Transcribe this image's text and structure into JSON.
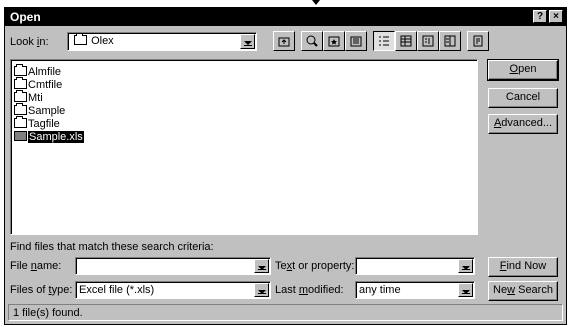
{
  "window": {
    "title": "Open",
    "help_glyph": "?",
    "close_glyph": "×"
  },
  "lookin": {
    "label_pre": "Look ",
    "label_u": "i",
    "label_post": "n:",
    "value": "Olex"
  },
  "toolbar": {
    "icons": [
      "up-folder-icon",
      "search-web-icon",
      "favorites-icon",
      "add-to-favorites-icon",
      "list-view-icon",
      "details-view-icon",
      "properties-view-icon",
      "preview-view-icon",
      "commands-icon"
    ]
  },
  "files": [
    {
      "name": "Almfile",
      "type": "folder"
    },
    {
      "name": "Cmtfile",
      "type": "folder"
    },
    {
      "name": "Mti",
      "type": "folder"
    },
    {
      "name": "Sample",
      "type": "folder"
    },
    {
      "name": "Tagfile",
      "type": "folder"
    },
    {
      "name": "Sample.xls",
      "type": "xls",
      "selected": true
    }
  ],
  "buttons": {
    "open": {
      "pre": "",
      "u": "O",
      "post": "pen"
    },
    "cancel": "Cancel",
    "advanced": {
      "pre": "",
      "u": "A",
      "post": "dvanced..."
    },
    "find_now": {
      "pre": "",
      "u": "F",
      "post": "ind Now"
    },
    "new_search": {
      "pre": "Ne",
      "u": "w",
      "post": " Search"
    }
  },
  "criteria": {
    "heading": "Find files that match these search criteria:",
    "file_name": {
      "pre": "File ",
      "u": "n",
      "post": "ame:",
      "value": ""
    },
    "file_type": {
      "pre": "Files of ",
      "u": "t",
      "post": "ype:",
      "value": "Excel file (*.xls)"
    },
    "text_prop": {
      "pre": "Te",
      "u": "x",
      "post": "t or property:",
      "value": ""
    },
    "last_mod": {
      "pre": "Last ",
      "u": "m",
      "post": "odified:",
      "value": "any time"
    }
  },
  "status": "1 file(s) found."
}
